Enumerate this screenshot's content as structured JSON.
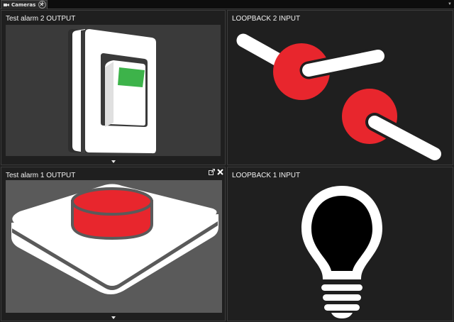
{
  "tabs": [
    {
      "label": "Cameras",
      "icon": "camera-icon",
      "closable": true
    }
  ],
  "tab_actions": {
    "add_tab_icon": "add-tab-icon",
    "add_tab_glyph": "+",
    "close_glyph": "✕",
    "menu_glyph": "▼"
  },
  "tiles": [
    {
      "title": "Test alarm 2 OUTPUT",
      "graphic": "wall-switch-icon",
      "state_color": "#3db34a"
    },
    {
      "title": "LOOPBACK 2 INPUT",
      "graphic": "toggle-levers-icon",
      "state_color": "#e8262d"
    },
    {
      "title": "Test alarm 1 OUTPUT",
      "graphic": "push-button-icon",
      "state_color": "#e8262d",
      "tools": [
        "popout-icon",
        "close-icon"
      ]
    },
    {
      "title": "LOOPBACK 1 INPUT",
      "graphic": "light-bulb-icon",
      "state_color": "#000000"
    }
  ]
}
